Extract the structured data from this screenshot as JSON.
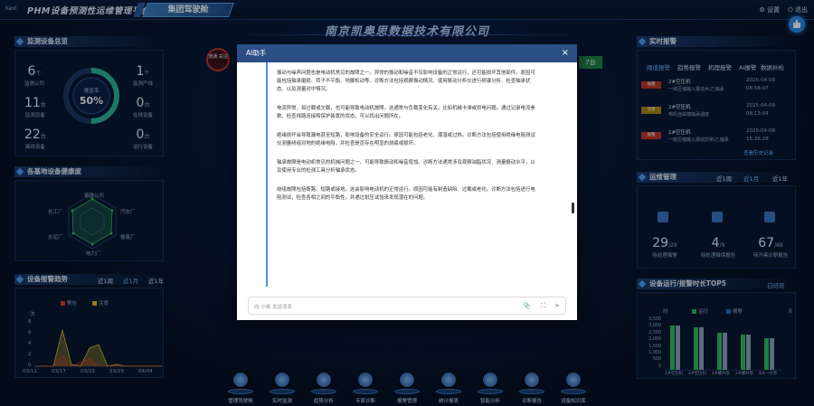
{
  "header": {
    "logo_text": "Kexi",
    "app_title": "PHM设备预测性运维管理平台",
    "group_tab": "集团驾驶舱",
    "settings": "设置",
    "logout": "退出"
  },
  "company": "南京凯奥思数据技术有限公司",
  "left": {
    "monitor_title": "监测设备总览",
    "stats": [
      {
        "n": "6",
        "u": "个",
        "l": "监测公司"
      },
      {
        "n": "11",
        "u": "台",
        "l": "监测设备"
      },
      {
        "n": "22",
        "u": "台",
        "l": "离线设备"
      },
      {
        "n": "1",
        "u": "个",
        "l": "监测产线"
      },
      {
        "n": "0",
        "u": "台",
        "l": "在线设备"
      },
      {
        "n": "0",
        "u": "台",
        "l": "运行设备"
      }
    ],
    "gauge_label": "覆盖率",
    "gauge_value": "50%",
    "gauge_fraction": 0.5,
    "health_title": "各基地设备健康度",
    "radar_labels": [
      "钢铁公司",
      "汽车厂",
      "报废厂",
      "电力厂",
      "水泥厂",
      "化工厂"
    ],
    "alarm_title": "设备报警趋势",
    "periods": [
      "近1周",
      "近1月",
      "近1年"
    ],
    "legend": [
      {
        "name": "警告",
        "color": "#e23b3b"
      },
      {
        "name": "注意",
        "color": "#e6c229"
      }
    ],
    "y_unit": "次",
    "y_ticks": [
      "8",
      "6",
      "4",
      "2",
      "0"
    ],
    "x_ticks": [
      "03/11",
      "03/17",
      "03/23",
      "03/29",
      "04/04"
    ]
  },
  "center": {
    "badge_left": "流通\n关注",
    "badge_right": "7台"
  },
  "right": {
    "alarm_title": "实时报警",
    "tabs": [
      "阈值报警",
      "趋势报警",
      "机理报警",
      "AI报警",
      "数据补检"
    ],
    "alarms": [
      {
        "level": "报警",
        "name": "2#空压机",
        "desc": "一级压缩输入振动大/乙轴承",
        "date": "2025-04-09",
        "time": "08:58:07",
        "color": "#c0392b"
      },
      {
        "level": "注意",
        "name": "2#空压机",
        "desc": "电机自由端轴承温度",
        "date": "2025-04-09",
        "time": "08:13:04",
        "color": "#b58a12"
      },
      {
        "level": "报警",
        "name": "1#空压机",
        "desc": "一级压缩输入振动异常/乙轴承",
        "date": "2025-04-08",
        "time": "15:26:28",
        "color": "#c0392b"
      }
    ],
    "view_more": "查看历史记录",
    "ops_title": "运维管理",
    "ops_periods": [
      "近1周",
      "近1月",
      "近1年"
    ],
    "ops": [
      {
        "n": "29",
        "d": "29",
        "l": "待处理报警"
      },
      {
        "n": "4",
        "d": "9",
        "l": "待处理维保报告"
      },
      {
        "n": "67",
        "d": "69",
        "l": "待开具诊断报告"
      }
    ],
    "top_title": "设备运行/报警时长TOP5",
    "top_link": "白班班",
    "top_legend": [
      "运行",
      "报警"
    ],
    "top_y_left": "时",
    "top_y_right": "天",
    "top_y_ticks": [
      "3,500",
      "3,000",
      "2,500",
      "2,000",
      "1,500",
      "1,000",
      "500",
      "0"
    ],
    "top_y_ticks_r": [
      "7",
      "6",
      "5",
      "4",
      "3",
      "2",
      "1",
      "0"
    ],
    "top_cats": [
      "1#空压机",
      "2#空压机",
      "1#螺杆泵",
      "2#螺杆泵",
      "B#一水泵"
    ]
  },
  "dialog": {
    "title": "AI助手",
    "close": "×",
    "paragraphs": [
      "振动与噪声问题也是电动机常见的故障之一。异常的振动和噪音不仅影响设备的正常运行，还可能损坏其他部件。原因可能包括轴承磨损、转子不平衡、地脚松动等。诊断方法包括观察振动情况、使用振动分析仪进行频谱分析、检查轴承状态、以及测量对中情况。",
      "电流异常，如过载或欠载，也可能导致电动机故障。这通常与负载变化有关，比如机械卡滞或供电问题。通过记录电流参数，检查线路连接和保护装置的状态，可以找出问题所在。",
      "绝缘损坏会导致漏电甚至短路，影响设备的安全运行。原因可能包括老化、潮湿或过热。诊断方法包括使用绝缘电阻测试仪测量绕组对地的绝缘电阻，并检查是否存在明显的烧痕或损坏。",
      "轴承故障是电动机常见的机械问题之一，可能导致振动和噪音增加。诊断方法通常涉及观察油脂状况、测量振动水平，以及使用专业的检测工具分析轴承状态。",
      "绕组故障包括断路、短路或接地。这会影响电动机的正常运行。原因可能有制造缺陷、过载或老化。诊断方法包括进行电阻测试，检查各相之间的平衡性，并通过耐压试验来发现潜在的问题。"
    ],
    "placeholder": "向 小奥 发送消息"
  },
  "bottom_nav": [
    "管理驾驶舱",
    "实时监测",
    "趋势分析",
    "专家诊断",
    "报警管理",
    "统计报表",
    "智能分析",
    "诊断报告",
    "设备知识库"
  ]
}
